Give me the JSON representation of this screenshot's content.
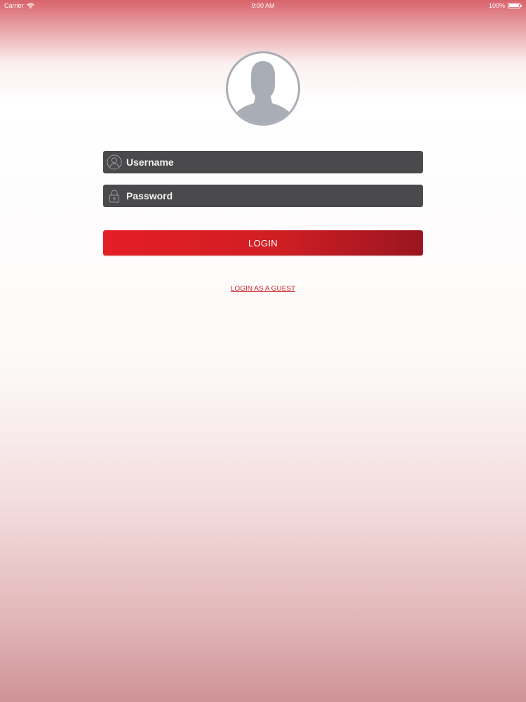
{
  "status_bar": {
    "carrier": "Carrier",
    "time": "9:00 AM",
    "battery": "100%",
    "icons": [
      "wifi-icon",
      "battery-icon"
    ]
  },
  "avatar": {
    "icon": "user-silhouette-icon"
  },
  "form": {
    "username": {
      "placeholder": "Username",
      "icon": "user-outline-icon"
    },
    "password": {
      "placeholder": "Password",
      "icon": "lock-icon"
    },
    "login_label": "LOGIN",
    "guest_label": "LOGIN AS A GUEST"
  },
  "colors": {
    "accent": "#e41e24",
    "accent_dark": "#9a1520",
    "field_bg": "#4a4a4c",
    "avatar_gray": "#a9aeb6",
    "link": "#d02a30"
  }
}
